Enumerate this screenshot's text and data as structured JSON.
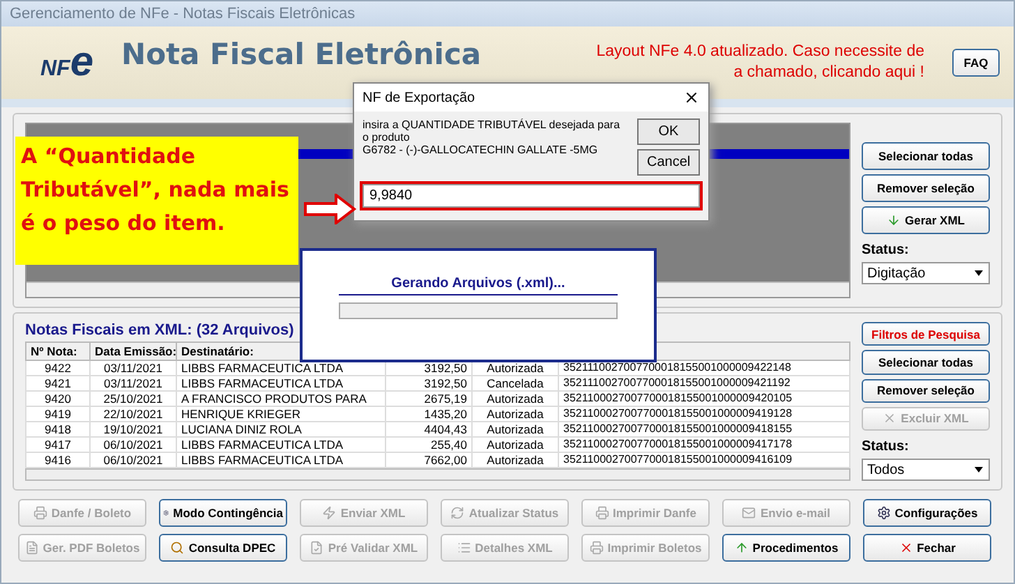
{
  "window": {
    "title": "Gerenciamento de NFe - Notas Fiscais Eletrônicas"
  },
  "header": {
    "logo": "NF",
    "logo_e": "e",
    "title": "Nota Fiscal Eletrônica",
    "notice_lines": [
      "Layout NFe 4.0 atualizado. Caso necessite de",
      "a chamado, clicando aqui !"
    ],
    "faq": "FAQ"
  },
  "upper_panel": {
    "buttons": [
      {
        "label": "Selecionar todas",
        "disabled": false
      },
      {
        "label": "Remover seleção",
        "disabled": false
      },
      {
        "label": "Gerar XML",
        "disabled": false
      }
    ],
    "status_label": "Status:",
    "status_value": "Digitação"
  },
  "lower_panel": {
    "title": "Notas Fiscais em XML: (32 Arquivos)",
    "filter_button": "Filtros de Pesquisa",
    "buttons": [
      {
        "label": "Selecionar todas",
        "disabled": false
      },
      {
        "label": "Remover seleção",
        "disabled": false
      },
      {
        "label": "Excluir XML",
        "disabled": true
      }
    ],
    "status_label": "Status:",
    "status_value": "Todos",
    "table": {
      "columns": [
        "Nº Nota:",
        "Data Emissão:",
        "Destinatário:"
      ],
      "rows": [
        [
          "9422",
          "03/11/2021",
          "LIBBS FARMACEUTICA LTDA",
          "3192,50",
          "Autorizada",
          "3521110027007700018155001000009422148"
        ],
        [
          "9421",
          "03/11/2021",
          "LIBBS FARMACEUTICA LTDA",
          "3192,50",
          "Cancelada",
          "3521110027007700018155001000009421192"
        ],
        [
          "9420",
          "25/10/2021",
          "A FRANCISCO PRODUTOS PARA",
          "2675,19",
          "Autorizada",
          "3521100027007700018155001000009420105"
        ],
        [
          "9419",
          "22/10/2021",
          "HENRIQUE KRIEGER",
          "1435,20",
          "Autorizada",
          "3521100027007700018155001000009419128"
        ],
        [
          "9418",
          "19/10/2021",
          "LUCIANA DINIZ ROLA",
          "4404,43",
          "Autorizada",
          "3521100027007700018155001000009418155"
        ],
        [
          "9417",
          "06/10/2021",
          "LIBBS FARMACEUTICA LTDA",
          "255,40",
          "Autorizada",
          "3521100027007700018155001000009417178"
        ],
        [
          "9416",
          "06/10/2021",
          "LIBBS FARMACEUTICA LTDA",
          "7662,00",
          "Autorizada",
          "3521100027007700018155001000009416109"
        ]
      ]
    }
  },
  "bottom_buttons": [
    {
      "label": "Danfe / Boleto",
      "disabled": true
    },
    {
      "label": "Modo Contingência",
      "disabled": false
    },
    {
      "label": "Enviar XML",
      "disabled": true
    },
    {
      "label": "Atualizar Status",
      "disabled": true
    },
    {
      "label": "Imprimir Danfe",
      "disabled": true
    },
    {
      "label": "Envio e-mail",
      "disabled": true
    },
    {
      "label": "Configurações",
      "disabled": false
    },
    {
      "label": "Ger. PDF Boletos",
      "disabled": true
    },
    {
      "label": "Consulta DPEC",
      "disabled": false
    },
    {
      "label": "Pré Validar XML",
      "disabled": true
    },
    {
      "label": "Detalhes XML",
      "disabled": true
    },
    {
      "label": "Imprimir Boletos",
      "disabled": true
    },
    {
      "label": "Procedimentos",
      "disabled": false
    },
    {
      "label": "Fechar",
      "disabled": false
    }
  ],
  "dialog": {
    "title": "NF de Exportação",
    "message": "insira a QUANTIDADE TRIBUTÁVEL desejada para o produto",
    "product": "G6782 - (-)-GALLOCATECHIN GALLATE -5MG",
    "ok": "OK",
    "cancel": "Cancel",
    "value": "9,9840"
  },
  "progress": {
    "title": "Gerando Arquivos (.xml)...",
    "level": 0
  },
  "annotation": {
    "text": "A “Quantidade Tributável”, nada mais é o peso do item."
  }
}
